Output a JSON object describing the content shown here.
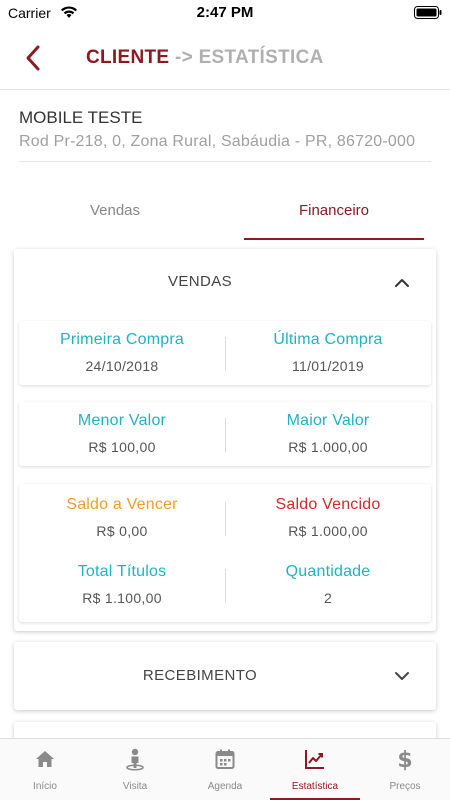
{
  "status_bar": {
    "carrier": "Carrier",
    "time": "2:47 PM"
  },
  "header": {
    "title": "CLIENTE",
    "separator": " -> ",
    "subtitle": "ESTATÍSTICA"
  },
  "client": {
    "name": "MOBILE TESTE",
    "address": "Rod Pr-218, 0, Zona Rural, Sabáudia - PR, 86720-000"
  },
  "tabs": [
    {
      "label": "Vendas",
      "active": false
    },
    {
      "label": "Financeiro",
      "active": true
    }
  ],
  "vendas_card": {
    "title": "VENDAS",
    "expanded": true,
    "primeira_compra": {
      "label": "Primeira Compra",
      "value": "24/10/2018"
    },
    "ultima_compra": {
      "label": "Última Compra",
      "value": "11/01/2019"
    },
    "menor_valor": {
      "label": "Menor Valor",
      "value": "R$ 100,00"
    },
    "maior_valor": {
      "label": "Maior Valor",
      "value": "R$ 1.000,00"
    },
    "saldo_a_vencer": {
      "label": "Saldo a Vencer",
      "value": "R$ 0,00"
    },
    "saldo_vencido": {
      "label": "Saldo Vencido",
      "value": "R$ 1.000,00"
    },
    "total_titulos": {
      "label": "Total Títulos",
      "value": "R$ 1.100,00"
    },
    "quantidade": {
      "label": "Quantidade",
      "value": "2"
    }
  },
  "recebimento_card": {
    "title": "RECEBIMENTO",
    "expanded": false
  },
  "bottom_nav": [
    {
      "label": "Início",
      "icon": "home-icon",
      "active": false
    },
    {
      "label": "Visita",
      "icon": "visit-person-icon",
      "active": false
    },
    {
      "label": "Agenda",
      "icon": "calendar-icon",
      "active": false
    },
    {
      "label": "Estatística",
      "icon": "chart-icon",
      "active": true
    },
    {
      "label": "Preços",
      "icon": "dollar-icon",
      "active": false
    }
  ],
  "colors": {
    "brand": "#8b1a22",
    "teal": "#1fb3c4",
    "orange": "#f39c2a",
    "red": "#d22b2b",
    "muted": "#a0a0a0"
  }
}
